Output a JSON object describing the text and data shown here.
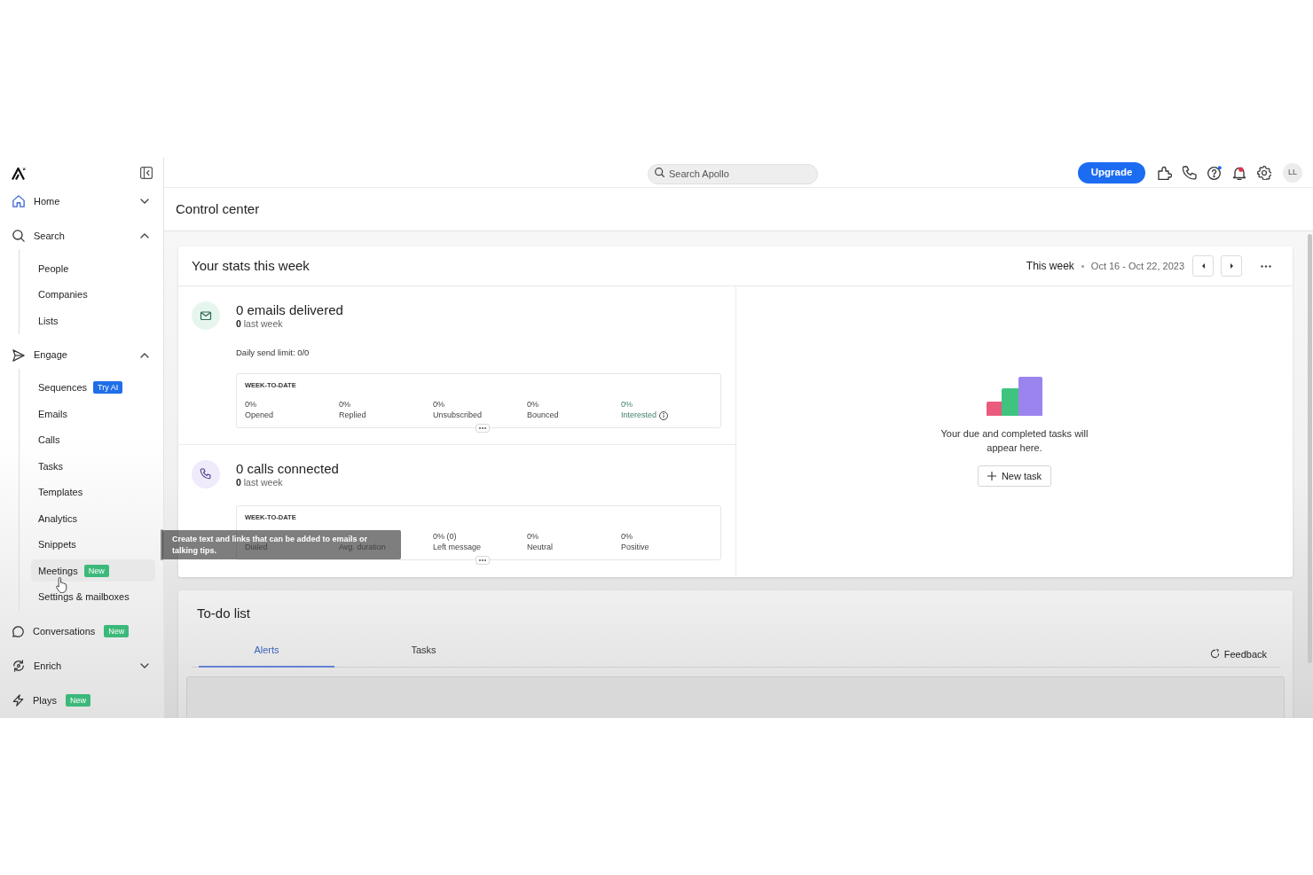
{
  "sidebar": {
    "sections": [
      {
        "label": "Home",
        "kind": "group",
        "expanded": false
      },
      {
        "label": "Search",
        "kind": "group",
        "expanded": true,
        "children": [
          {
            "label": "People",
            "selected": false
          },
          {
            "label": "Companies",
            "selected": false
          },
          {
            "label": "Lists",
            "selected": false
          }
        ]
      },
      {
        "label": "Engage",
        "kind": "group",
        "expanded": true,
        "children": [
          {
            "label": "Sequences",
            "selected": false,
            "badge": {
              "text": "Try AI",
              "color": "#1f6fe8"
            }
          },
          {
            "label": "Emails",
            "selected": false
          },
          {
            "label": "Calls",
            "selected": false
          },
          {
            "label": "Tasks",
            "selected": false
          },
          {
            "label": "Templates",
            "selected": false
          },
          {
            "label": "Analytics",
            "selected": false
          },
          {
            "label": "Snippets",
            "selected": false
          },
          {
            "label": "Meetings",
            "selected": true,
            "badge": {
              "text": "New",
              "color": "#3cb97a"
            }
          },
          {
            "label": "Settings & mailboxes",
            "selected": false
          }
        ]
      },
      {
        "label": "Conversations",
        "kind": "link",
        "badge": {
          "text": "New",
          "color": "#3cb97a"
        }
      },
      {
        "label": "Enrich",
        "kind": "group",
        "expanded": false
      },
      {
        "label": "Plays",
        "kind": "link",
        "badge": {
          "text": "New",
          "color": "#3cb97a"
        }
      }
    ]
  },
  "top_bar": {
    "search": {
      "placeholder": "Search Apollo"
    },
    "upgrade_button": "Upgrade",
    "avatar": "LL"
  },
  "page": {
    "title": "Control center"
  },
  "stats": {
    "title": "Your stats this week",
    "period": "This week",
    "date_range": "Oct 16 - Oct 22, 2023",
    "sections": [
      {
        "kind": "email",
        "headline": "0 emails delivered",
        "last_week": "**0** last week",
        "send_limit": "Daily send limit: 0/0",
        "panel_heading": "WEEK-TO-DATE",
        "stats": [
          {
            "value": "0%",
            "label": "Opened",
            "info_icon": false
          },
          {
            "value": "0%",
            "label": "Replied",
            "info_icon": false
          },
          {
            "value": "0%",
            "label": "Unsubscribed",
            "info_icon": false
          },
          {
            "value": "0%",
            "label": "Bounced",
            "info_icon": false
          },
          {
            "value": "0%",
            "label": "Interested",
            "info_icon": true
          }
        ]
      },
      {
        "kind": "call",
        "headline": "0 calls connected",
        "last_week": "**0** last week",
        "panel_heading": "WEEK-TO-DATE",
        "stats": [
          {
            "label": "Dialed",
            "info_icon": false
          },
          {
            "label": "Avg. duration",
            "info_icon": false
          },
          {
            "value": "0% (0)",
            "label": "Left message",
            "info_icon": false
          },
          {
            "value": "0%",
            "label": "Neutral",
            "info_icon": false
          },
          {
            "value": "0%",
            "label": "Positive",
            "info_icon": false
          }
        ]
      }
    ]
  },
  "tasks_panel": {
    "empty_text": "Your due and completed tasks will appear here.",
    "new_task_button": "New task"
  },
  "tooltip": {
    "text": "Create text and links that can be added to emails or talking tips."
  },
  "todo": {
    "title": "To-do list",
    "tabs": [
      {
        "label": "Alerts",
        "selected": true
      },
      {
        "label": "Tasks",
        "selected": false
      }
    ],
    "feedback_button": "Feedback"
  }
}
